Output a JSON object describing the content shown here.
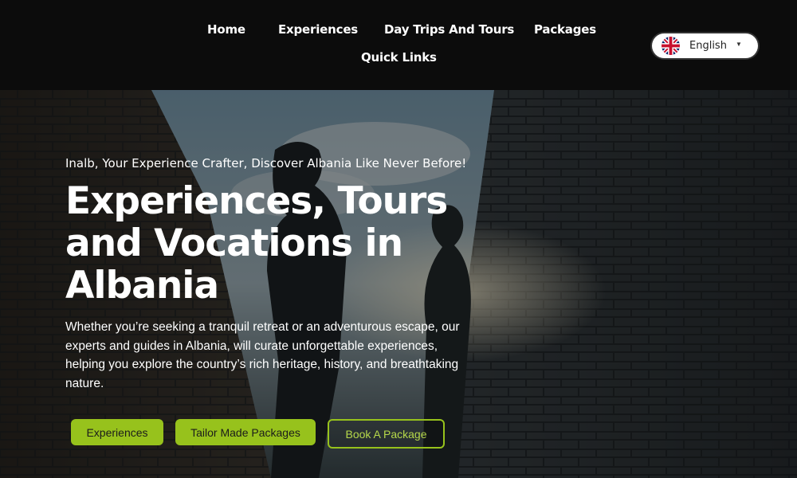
{
  "nav": {
    "items": [
      {
        "label": "Home"
      },
      {
        "label": "Experiences"
      },
      {
        "label": "Day Trips And Tours"
      },
      {
        "label": "Packages"
      },
      {
        "label": "Quick Links"
      }
    ]
  },
  "language": {
    "selected": "English",
    "flag_icon": "uk-flag-icon",
    "caret": "▼"
  },
  "hero": {
    "tagline": "Inalb, Your Experience Crafter, Discover Albania Like Never Before!",
    "headline": "Experiences, Tours and Vocations in Albania",
    "description": "Whether you’re seeking a tranquil retreat or an adventurous escape, our experts and guides in Albania, will curate unforgettable experiences, helping you explore the country’s rich heritage, history, and breathtaking nature.",
    "buttons": {
      "experiences": "Experiences",
      "tailor_made": "Tailor Made Packages",
      "book": "Book A Package"
    }
  },
  "colors": {
    "accent": "#97c21c",
    "header_bg": "#0c0c0c"
  }
}
